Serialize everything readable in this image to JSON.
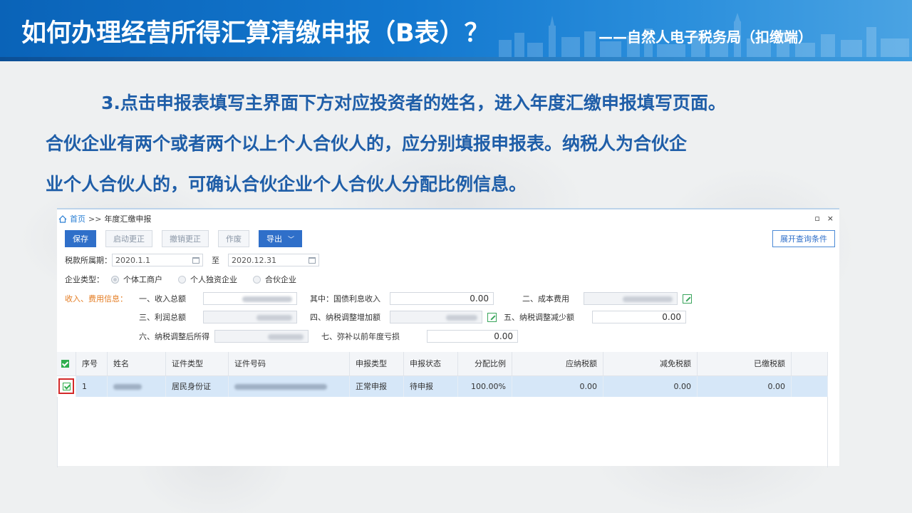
{
  "header": {
    "title": "如何办理经营所得汇算清缴申报（B表）？",
    "subtitle": "——自然人电子税务局（扣缴端）"
  },
  "paragraph": {
    "line1": "3.点击申报表填写主界面下方对应投资者的姓名，进入年度汇缴申报填写页面。",
    "line2": "合伙企业有两个或者两个以上个人合伙人的，应分别填报申报表。纳税人为合伙企",
    "line3": "业个人合伙人的，可确认合伙企业个人合伙人分配比例信息。"
  },
  "app": {
    "breadcrumb": {
      "home": "首页",
      "sep": ">>",
      "current": "年度汇缴申报"
    },
    "window_controls": [
      "▫",
      "×"
    ],
    "toolbar": {
      "save": "保存",
      "start_correction": "启动更正",
      "cancel_correction": "撤销更正",
      "void": "作废",
      "export": "导出",
      "expand_query": "展开查询条件"
    },
    "period": {
      "label": "税款所属期：",
      "start": "2020.1.1",
      "to": "至",
      "end": "2020.12.31"
    },
    "enterprise_type": {
      "label": "企业类型：",
      "options": [
        "个体工商户",
        "个人独资企业",
        "合伙企业"
      ],
      "selected": "个体工商户"
    },
    "income_info": {
      "label": "收入、费用信息：",
      "row1": {
        "a_label": "一、收入总额",
        "b_label": "其中：国债利息收入",
        "b_value": "0.00",
        "c_label": "二、成本费用"
      },
      "row2": {
        "a_label": "三、利润总额",
        "b_label": "四、纳税调整增加额",
        "c_label": "五、纳税调整减少额",
        "c_value": "0.00"
      },
      "row3": {
        "a_label": "六、纳税调整后所得",
        "b_label": "七、弥补以前年度亏损",
        "b_value": "0.00"
      }
    },
    "table": {
      "headers": [
        "序号",
        "姓名",
        "证件类型",
        "证件号码",
        "申报类型",
        "申报状态",
        "分配比例",
        "应纳税额",
        "减免税额",
        "已缴税额"
      ],
      "rows": [
        {
          "no": "1",
          "id_type": "居民身份证",
          "report_type": "正常申报",
          "status": "待申报",
          "ratio": "100.00%",
          "tax_due": "0.00",
          "tax_relief": "0.00",
          "tax_paid": "0.00"
        }
      ]
    }
  }
}
